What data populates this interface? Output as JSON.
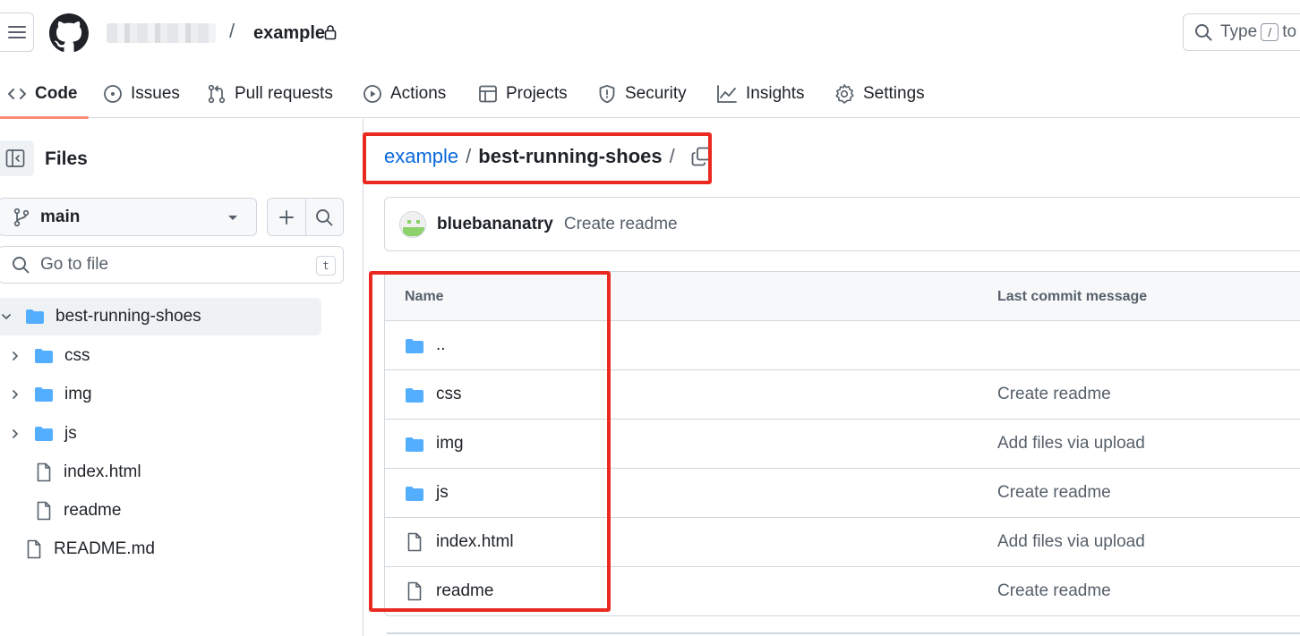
{
  "header": {
    "repo_separator": "/",
    "repo_name": "example",
    "search_placeholder_prefix": "Type",
    "search_placeholder_key": "/",
    "search_placeholder_suffix": "to"
  },
  "nav": {
    "tabs": [
      {
        "label": "Code",
        "icon": "code-icon",
        "active": true
      },
      {
        "label": "Issues",
        "icon": "issue-opened-icon"
      },
      {
        "label": "Pull requests",
        "icon": "git-pull-request-icon"
      },
      {
        "label": "Actions",
        "icon": "play-icon"
      },
      {
        "label": "Projects",
        "icon": "table-icon"
      },
      {
        "label": "Security",
        "icon": "shield-icon"
      },
      {
        "label": "Insights",
        "icon": "graph-icon"
      },
      {
        "label": "Settings",
        "icon": "gear-icon"
      }
    ]
  },
  "sidebar": {
    "title": "Files",
    "branch": "main",
    "goto_placeholder": "Go to file",
    "goto_shortcut": "t",
    "tree": [
      {
        "label": "best-running-shoes",
        "type": "folder-open",
        "expanded": true,
        "selected": true
      },
      {
        "label": "css",
        "type": "folder"
      },
      {
        "label": "img",
        "type": "folder"
      },
      {
        "label": "js",
        "type": "folder"
      },
      {
        "label": "index.html",
        "type": "file"
      },
      {
        "label": "readme",
        "type": "file"
      },
      {
        "label": "README.md",
        "type": "file"
      }
    ]
  },
  "main": {
    "breadcrumb": {
      "root": "example",
      "sep": "/",
      "current": "best-running-shoes",
      "trailing_sep": "/"
    },
    "latest_commit": {
      "user": "bluebananatry",
      "message": "Create readme"
    },
    "table": {
      "col_name": "Name",
      "col_message": "Last commit message",
      "rows": [
        {
          "name": "..",
          "type": "folder",
          "message": ""
        },
        {
          "name": "css",
          "type": "folder",
          "message": "Create readme"
        },
        {
          "name": "img",
          "type": "folder",
          "message": "Add files via upload"
        },
        {
          "name": "js",
          "type": "folder",
          "message": "Create readme"
        },
        {
          "name": "index.html",
          "type": "file",
          "message": "Add files via upload"
        },
        {
          "name": "readme",
          "type": "file",
          "message": "Create readme"
        }
      ]
    }
  },
  "colors": {
    "link": "#0969da",
    "folder": "#54aeff",
    "active_tab_underline": "#fd8c73",
    "highlight_box": "#ea2a20",
    "border": "#d0d7de"
  }
}
